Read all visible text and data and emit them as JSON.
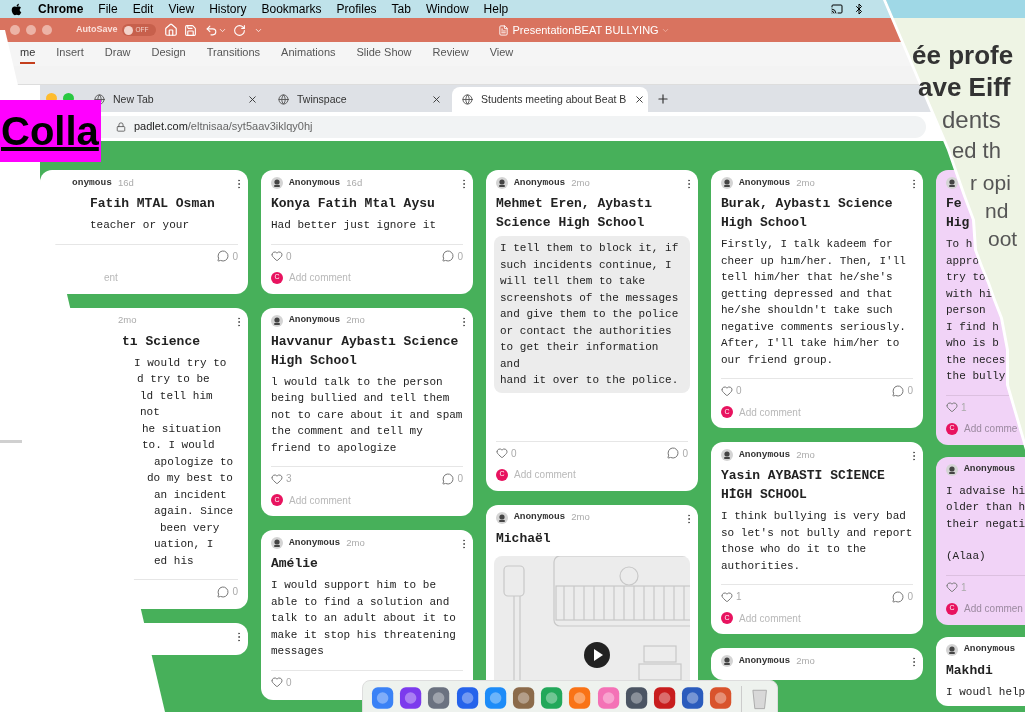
{
  "menubar": {
    "app": "Chrome",
    "items": [
      "File",
      "Edit",
      "View",
      "History",
      "Bookmarks",
      "Profiles",
      "Tab",
      "Window",
      "Help"
    ]
  },
  "powerpoint": {
    "autosave_label": "AutoSave",
    "autosave_on": false,
    "autosave_state": "OFF",
    "title": "PresentationBEAT BULLYING",
    "ribbon_tabs": [
      {
        "label": "me",
        "selected": true
      },
      {
        "label": "Insert",
        "selected": false
      },
      {
        "label": "Draw",
        "selected": false
      },
      {
        "label": "Design",
        "selected": false
      },
      {
        "label": "Transitions",
        "selected": false
      },
      {
        "label": "Animations",
        "selected": false
      },
      {
        "label": "Slide Show",
        "selected": false
      },
      {
        "label": "Review",
        "selected": false
      },
      {
        "label": "View",
        "selected": false
      }
    ]
  },
  "browser": {
    "tabs": [
      {
        "title": "New Tab",
        "selected": false
      },
      {
        "title": "Twinspace",
        "selected": false
      },
      {
        "title": "Students meeting about Beat B",
        "selected": true
      }
    ],
    "url_host": "padlet.com",
    "url_path": "/eltnisaa/syt5aav3iklqy0hj"
  },
  "overlay_label": "Colla",
  "slide_fragments": [
    "ée profe",
    "ave Eiff",
    "dents",
    "ed th",
    "r opi",
    "nd",
    "oot"
  ],
  "columns": [
    {
      "cards": [
        {
          "kind": "clipped",
          "color": "#ffffff",
          "menu": true,
          "author": "onymous",
          "time": "16d",
          "title": [
            "Fatih MTAL Osman"
          ],
          "body": [
            "teacher or your"
          ],
          "comments": "0",
          "add_comment": "ent"
        },
        {
          "kind": "clipped",
          "color": "#ffffff",
          "menu": true,
          "time": "2mo",
          "title": [
            "tı Science"
          ],
          "body": [
            "I would try to",
            "d try to be",
            "ld tell him not",
            "he situation",
            "to. I would",
            "apologize to",
            "do my best to",
            "an incident",
            "again. Since",
            "been very",
            "uation, I",
            "ed his"
          ],
          "comments": "0"
        },
        {
          "kind": "clipped",
          "color": "#ffffff",
          "menu": true
        }
      ]
    },
    {
      "cards": [
        {
          "kind": "text",
          "color": "#ffffff",
          "menu": true,
          "author": "Anonymous",
          "time": "16d",
          "title": [
            "Konya Fatih Mtal Aysu"
          ],
          "body": [
            "Had better just ignore it"
          ],
          "likes": "0",
          "comments": "0",
          "commenter": "C",
          "add_comment": "Add comment"
        },
        {
          "kind": "text",
          "color": "#ffffff",
          "menu": true,
          "author": "Anonymous",
          "time": "2mo",
          "title": [
            "Havvanur Aybastı Science",
            "High School"
          ],
          "body": [
            "l would talk to the person",
            "being bullied and tell them",
            "not to care about it and spam",
            "the comment and tell my",
            "friend to apologize"
          ],
          "likes": "3",
          "comments": "0",
          "commenter": "C",
          "add_comment": "Add comment"
        },
        {
          "kind": "text",
          "color": "#ffffff",
          "menu": true,
          "author": "Anonymous",
          "time": "2mo",
          "title": [
            "Amélie"
          ],
          "body": [
            "I would support him to be",
            "able to find a solution and",
            "talk to an adult about it to",
            "make it stop his threatening",
            "messages"
          ],
          "likes": "0"
        }
      ]
    },
    {
      "cards": [
        {
          "kind": "quote",
          "color": "#ffffff",
          "menu": true,
          "author": "Anonymous",
          "time": "2mo",
          "title": [
            "Mehmet Eren, Aybastı",
            "Science High School"
          ],
          "body": [
            "I tell them to block it, if",
            "such incidents continue, I",
            "will tell them to take",
            "screenshots of the messages",
            "and give them to the police",
            "or contact the authorities",
            "to get their information and",
            "hand it over to the police."
          ],
          "likes": "0",
          "comments": "0",
          "commenter": "C",
          "add_comment": "Add comment"
        },
        {
          "kind": "video",
          "color": "#ffffff",
          "menu": true,
          "author": "Anonymous",
          "time": "2mo",
          "title": [
            "Michaël"
          ]
        }
      ]
    },
    {
      "cards": [
        {
          "kind": "text",
          "color": "#ffffff",
          "menu": true,
          "author": "Anonymous",
          "time": "2mo",
          "title": [
            "Burak, Aybastı Science",
            "High School"
          ],
          "body": [
            "Firstly, I talk kadeem for",
            "cheer up hım/her. Then, I'll",
            "tell him/her that he/she's",
            "getting depressed and that",
            "he/she shouldn't take such",
            "negative comments seriously.",
            "After, I'll take him/her to",
            "our friend group."
          ],
          "likes": "0",
          "comments": "0",
          "commenter": "C",
          "add_comment": "Add comment"
        },
        {
          "kind": "text",
          "color": "#ffffff",
          "menu": true,
          "author": "Anonymous",
          "time": "2mo",
          "title": [
            "Yasin AYBASTI SCİENCE",
            "HİGH SCHOOL"
          ],
          "body": [
            "I think bullying is very bad",
            "so let's not bully and report",
            "those who do it to the",
            "authorities."
          ],
          "likes": "1",
          "comments": "0",
          "commenter": "C",
          "add_comment": "Add comment"
        },
        {
          "kind": "text",
          "color": "#ffffff",
          "menu": true,
          "author": "Anonymous",
          "time": "2mo"
        }
      ]
    },
    {
      "cards": [
        {
          "kind": "clipped",
          "color": "#f1d3f7",
          "menu": false,
          "title": [
            "Fe",
            "Hig"
          ],
          "body": [
            "To h",
            "appro",
            "try to",
            "with hi",
            "person",
            "I find h",
            "who is b",
            "the neces",
            "the bully"
          ],
          "likes": "1",
          "commenter": "C",
          "add_comment": "Add comme"
        },
        {
          "kind": "clipped",
          "color": "#f1d3f7",
          "menu": false,
          "author": "Anonymous",
          "body": [
            "I advaise hi",
            "older than h",
            "their negati"
          ],
          "note": "(Alaa)",
          "likes": "1",
          "commenter": "C",
          "add_comment": "Add commen"
        },
        {
          "kind": "clipped",
          "color": "#ffffff",
          "menu": false,
          "author": "Anonymous",
          "title": [
            "Makhdi"
          ],
          "body": [
            "I woudl help"
          ]
        }
      ]
    }
  ]
}
